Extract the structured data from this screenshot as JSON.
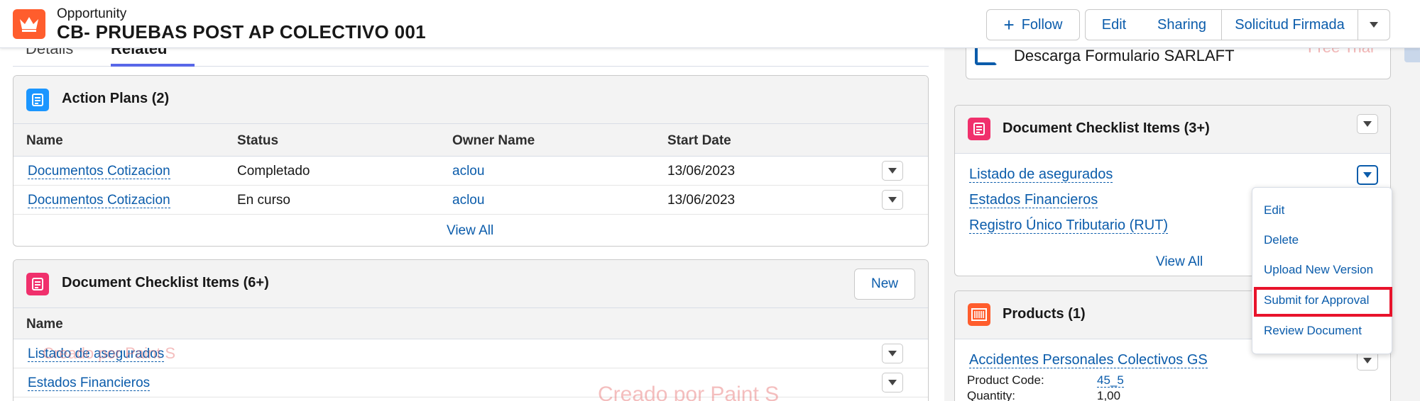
{
  "header": {
    "object_type": "Opportunity",
    "record_title": "CB- PRUEBAS POST AP COLECTIVO 001",
    "buttons": {
      "follow": "Follow",
      "edit": "Edit",
      "sharing": "Sharing",
      "solicitud": "Solicitud Firmada"
    }
  },
  "tabs": {
    "details": "Details",
    "related": "Related"
  },
  "action_plans": {
    "title": "Action Plans (2)",
    "columns": [
      "Name",
      "Status",
      "Owner Name",
      "Start Date"
    ],
    "rows": [
      {
        "name": "Documentos Cotizacion",
        "status": "Completado",
        "owner": "aclou",
        "start": "13/06/2023"
      },
      {
        "name": "Documentos Cotizacion",
        "status": "En curso",
        "owner": "aclou",
        "start": "13/06/2023"
      }
    ],
    "view_all": "View All"
  },
  "left_checklist": {
    "title": "Document Checklist Items (6+)",
    "new_label": "New",
    "column": "Name",
    "rows": [
      "Listado de asegurados",
      "Estados Financieros"
    ]
  },
  "right_top": {
    "item": "Descarga Formulario SARLAFT",
    "watermark": "Free Trial"
  },
  "right_checklist": {
    "title": "Document Checklist Items (3+)",
    "items": [
      "Listado de asegurados",
      "Estados Financieros",
      "Registro Único Tributario (RUT)"
    ],
    "view_all": "View All"
  },
  "dropdown_menu": {
    "items": [
      "Edit",
      "Delete",
      "Upload New Version",
      "Submit for Approval",
      "Review Document"
    ]
  },
  "products": {
    "title": "Products (1)",
    "product_name": "Accidentes Personales Colectivos GS",
    "code_label": "Product Code:",
    "code_value": "45_5",
    "qty_label": "Quantity:",
    "qty_value": "1,00"
  },
  "watermarks": {
    "paint_1": "Creado por Paint S",
    "paint_2": "Creado por Paint S"
  },
  "colors": {
    "accent": "#0b5cab",
    "opportunity_icon": "#ff5d2d",
    "action_plan_icon": "#1b96ff",
    "checklist_icon": "#f0306c",
    "products_icon": "#ff5d2d",
    "highlight": "#e8132b"
  }
}
